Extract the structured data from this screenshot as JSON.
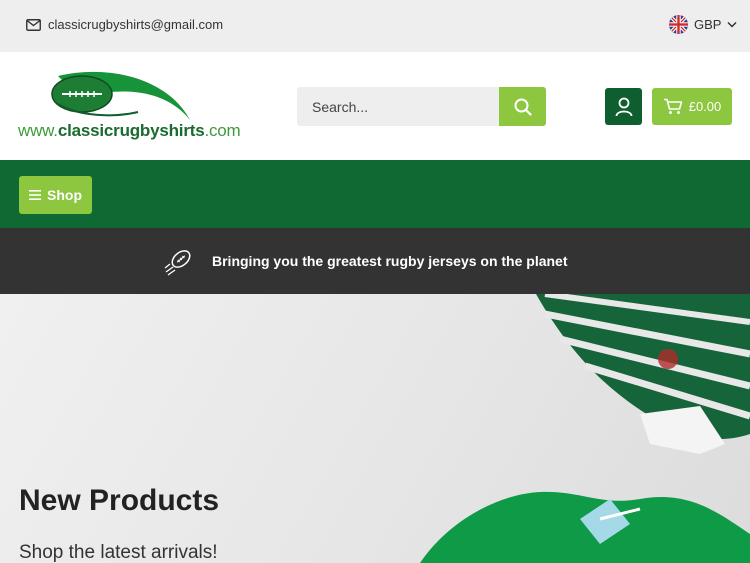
{
  "topbar": {
    "email": "classicrugbyshirts@gmail.com",
    "currency": "GBP"
  },
  "header": {
    "logo": {
      "part1": "www.",
      "part2": "classicrugbyshirts",
      "part3": ".com"
    },
    "search_placeholder": "Search...",
    "cart_total": "£0.00"
  },
  "nav": {
    "shop_label": "Shop"
  },
  "promo": {
    "text": "Bringing you the greatest rugby jerseys on the planet"
  },
  "hero": {
    "title": "New Products",
    "subtitle": "Shop the latest arrivals!"
  },
  "colors": {
    "dark_green": "#0e6a32",
    "light_green": "#8dc63f",
    "banner": "#333333"
  }
}
